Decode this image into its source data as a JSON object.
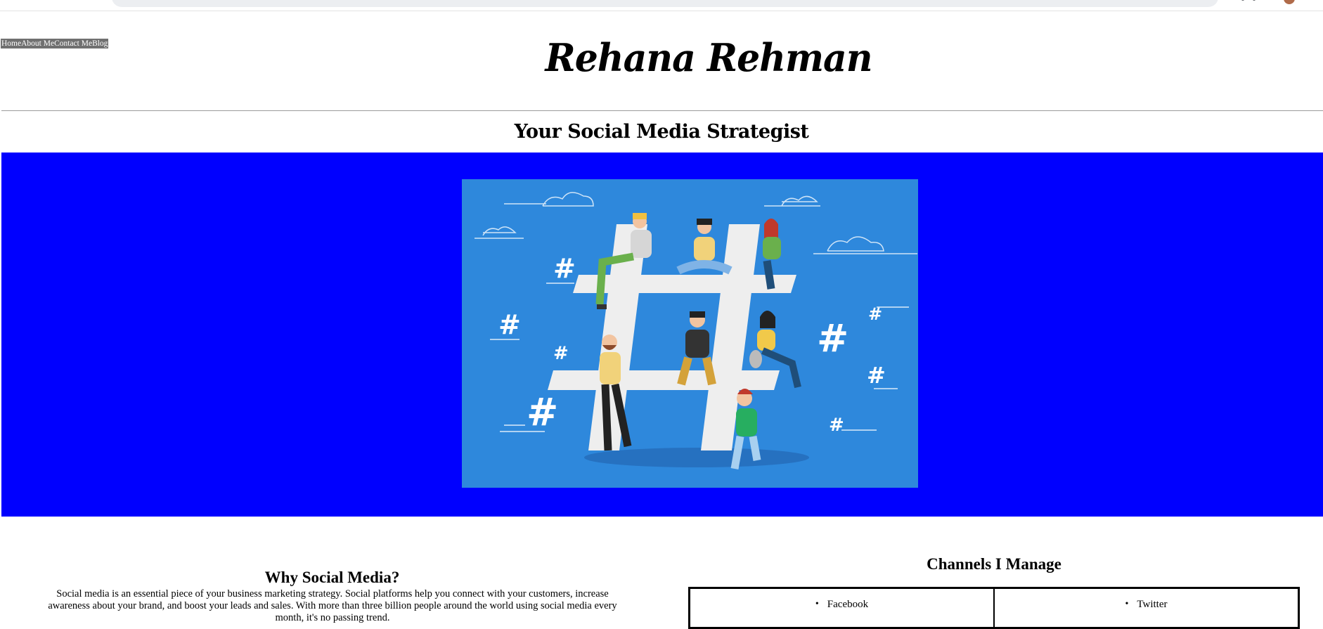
{
  "nav": {
    "items": [
      {
        "label": "Home"
      },
      {
        "label": "About Me"
      },
      {
        "label": "Contact Me"
      },
      {
        "label": "Blog"
      }
    ]
  },
  "header": {
    "brand_name": "Rehana Rehman",
    "subtitle": "Your Social Media Strategist"
  },
  "hero": {
    "background_color": "#0000ff",
    "image_bg_color": "#2e88dc",
    "image_icon": "hashtag-people-illustration"
  },
  "why": {
    "title": "Why Social Media?",
    "text": "Social media is an essential piece of your business marketing strategy. Social platforms help you connect with your customers, increase awareness about your brand, and boost your leads and sales. With more than three billion people around the world using social media every month, it's no passing trend."
  },
  "channels": {
    "title": "Channels I Manage",
    "items": [
      {
        "label": "Facebook"
      },
      {
        "label": "Twitter"
      }
    ]
  }
}
